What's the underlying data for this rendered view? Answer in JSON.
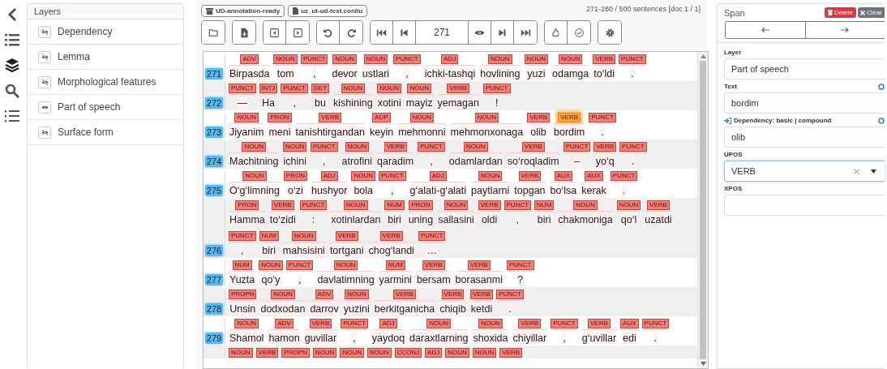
{
  "layers": {
    "title": "Layers",
    "items": [
      {
        "label": "Dependency",
        "visible": false
      },
      {
        "label": "Lemma",
        "visible": false
      },
      {
        "label": "Morphological features",
        "visible": false
      },
      {
        "label": "Part of speech",
        "visible": true
      },
      {
        "label": "Surface form",
        "visible": false
      }
    ]
  },
  "document": {
    "badges": [
      {
        "kind": "collection",
        "label": "UD-annotation-ready"
      },
      {
        "kind": "file",
        "label": "uz_ut-ud-test.conllu"
      }
    ],
    "status": "271-280 / 500 sentences [doc 1 / 1]",
    "sentence_field": "271"
  },
  "sentences": [
    {
      "number": "271",
      "tokens": [
        {
          "text": "Birpasda",
          "pos": "ADV",
          "selected": false
        },
        {
          "text": "tom",
          "pos": "NOUN",
          "selected": false
        },
        {
          "text": ",",
          "pos": "PUNCT",
          "selected": false
        },
        {
          "text": "devor",
          "pos": "NOUN",
          "selected": false
        },
        {
          "text": "ustlari",
          "pos": "NOUN",
          "selected": false
        },
        {
          "text": ",",
          "pos": "PUNCT",
          "selected": false
        },
        {
          "text": "ichki-tashqi",
          "pos": "ADJ",
          "selected": false
        },
        {
          "text": "hovlining",
          "pos": "NOUN",
          "selected": false
        },
        {
          "text": "yuzi",
          "pos": "NOUN",
          "selected": false
        },
        {
          "text": "odamga",
          "pos": "NOUN",
          "selected": false
        },
        {
          "text": "to‘ldi",
          "pos": "VERB",
          "selected": false
        },
        {
          "text": ".",
          "pos": "PUNCT",
          "selected": false
        }
      ]
    },
    {
      "number": "272",
      "tokens": [
        {
          "text": "—",
          "pos": "PUNCT",
          "selected": false
        },
        {
          "text": "Ha",
          "pos": "INTJ",
          "selected": false
        },
        {
          "text": ",",
          "pos": "PUNCT",
          "selected": false
        },
        {
          "text": "bu",
          "pos": "DET",
          "selected": false
        },
        {
          "text": "kishining",
          "pos": "NOUN",
          "selected": false
        },
        {
          "text": "xotini",
          "pos": "NOUN",
          "selected": false
        },
        {
          "text": "mayiz",
          "pos": "NOUN",
          "selected": false
        },
        {
          "text": "yemagan",
          "pos": "VERB",
          "selected": false
        },
        {
          "text": "!",
          "pos": "PUNCT",
          "selected": false
        }
      ]
    },
    {
      "number": "273",
      "tokens": [
        {
          "text": "Jiyanim",
          "pos": "NOUN",
          "selected": false
        },
        {
          "text": "meni",
          "pos": "PRON",
          "selected": false
        },
        {
          "text": "tanishtirgandan",
          "pos": "VERB",
          "selected": false
        },
        {
          "text": "keyin",
          "pos": "ADP",
          "selected": false
        },
        {
          "text": "mehmonni",
          "pos": "NOUN",
          "selected": false
        },
        {
          "text": "mehmonxonaga",
          "pos": "NOUN",
          "selected": false
        },
        {
          "text": "olib",
          "pos": "VERB",
          "selected": false
        },
        {
          "text": "bordim",
          "pos": "VERB",
          "selected": true
        },
        {
          "text": ".",
          "pos": "PUNCT",
          "selected": false
        }
      ]
    },
    {
      "number": "274",
      "tokens": [
        {
          "text": "Machitning",
          "pos": "NOUN",
          "selected": false
        },
        {
          "text": "ichini",
          "pos": "NOUN",
          "selected": false
        },
        {
          "text": ",",
          "pos": "PUNCT",
          "selected": false
        },
        {
          "text": "atrofini",
          "pos": "NOUN",
          "selected": false
        },
        {
          "text": "qaradim",
          "pos": "VERB",
          "selected": false
        },
        {
          "text": ",",
          "pos": "PUNCT",
          "selected": false
        },
        {
          "text": "odamlardan",
          "pos": "NOUN",
          "selected": false
        },
        {
          "text": "so‘roqladim",
          "pos": "VERB",
          "selected": false
        },
        {
          "text": "–",
          "pos": "PUNCT",
          "selected": false
        },
        {
          "text": "yo‘q",
          "pos": "VERB",
          "selected": false
        },
        {
          "text": ".",
          "pos": "PUNCT",
          "selected": false
        }
      ]
    },
    {
      "number": "275",
      "tokens": [
        {
          "text": "O‘g‘limning",
          "pos": "NOUN",
          "selected": false
        },
        {
          "text": "o‘zi",
          "pos": "PRON",
          "selected": false
        },
        {
          "text": "hushyor",
          "pos": "ADJ",
          "selected": false
        },
        {
          "text": "bola",
          "pos": "NOUN",
          "selected": false
        },
        {
          "text": ",",
          "pos": "PUNCT",
          "selected": false
        },
        {
          "text": "g‘alati-g‘alati",
          "pos": "ADJ",
          "selected": false
        },
        {
          "text": "paytlarni",
          "pos": "NOUN",
          "selected": false
        },
        {
          "text": "topgan",
          "pos": "VERB",
          "selected": false
        },
        {
          "text": "bo‘lsa",
          "pos": "AUX",
          "selected": false
        },
        {
          "text": "kerak",
          "pos": "AUX",
          "selected": false
        },
        {
          "text": ".",
          "pos": "PUNCT",
          "selected": false
        }
      ]
    },
    {
      "number": "276",
      "tokens": [
        {
          "text": "Hamma",
          "pos": "PRON",
          "selected": false
        },
        {
          "text": "to‘zidi",
          "pos": "VERB",
          "selected": false
        },
        {
          "text": ":",
          "pos": "PUNCT",
          "selected": false
        },
        {
          "text": "xotinlardan",
          "pos": "NOUN",
          "selected": false
        },
        {
          "text": "biri",
          "pos": "NUM",
          "selected": false
        },
        {
          "text": "uning",
          "pos": "PRON",
          "selected": false
        },
        {
          "text": "sallasini",
          "pos": "NOUN",
          "selected": false
        },
        {
          "text": "oldi",
          "pos": "VERB",
          "selected": false
        },
        {
          "text": ",",
          "pos": "PUNCT",
          "selected": false
        },
        {
          "text": "biri",
          "pos": "NUM",
          "selected": false
        },
        {
          "text": "chakmoniga",
          "pos": "NOUN",
          "selected": false
        },
        {
          "text": "qo‘l",
          "pos": "NOUN",
          "selected": false
        },
        {
          "text": "uzatdi",
          "pos": "VERB",
          "selected": false
        },
        {
          "text": ",",
          "pos": "PUNCT",
          "selected": false
        },
        {
          "text": "biri",
          "pos": "NUM",
          "selected": false
        },
        {
          "text": "mahsisini",
          "pos": "NOUN",
          "selected": false
        },
        {
          "text": "tortgani",
          "pos": "VERB",
          "selected": false
        },
        {
          "text": "chog‘landi",
          "pos": "VERB",
          "selected": false
        },
        {
          "text": "…",
          "pos": "PUNCT",
          "selected": false
        }
      ]
    },
    {
      "number": "277",
      "tokens": [
        {
          "text": "Yuzta",
          "pos": "NUM",
          "selected": false
        },
        {
          "text": "qo‘y",
          "pos": "NOUN",
          "selected": false
        },
        {
          "text": ",",
          "pos": "PUNCT",
          "selected": false
        },
        {
          "text": "davlatimning",
          "pos": "NOUN",
          "selected": false
        },
        {
          "text": "yarmini",
          "pos": "NUM",
          "selected": false
        },
        {
          "text": "bersam",
          "pos": "VERB",
          "selected": false
        },
        {
          "text": "borasanmi",
          "pos": "VERB",
          "selected": false
        },
        {
          "text": "?",
          "pos": "PUNCT",
          "selected": false
        }
      ]
    },
    {
      "number": "278",
      "tokens": [
        {
          "text": "Unsin",
          "pos": "PROPN",
          "selected": false
        },
        {
          "text": "dodxodan",
          "pos": "NOUN",
          "selected": false
        },
        {
          "text": "darrov",
          "pos": "ADV",
          "selected": false
        },
        {
          "text": "yuzini",
          "pos": "NOUN",
          "selected": false
        },
        {
          "text": "berkitganicha",
          "pos": "VERB",
          "selected": false
        },
        {
          "text": "chiqib",
          "pos": "VERB",
          "selected": false
        },
        {
          "text": "ketdi",
          "pos": "VERB",
          "selected": false
        },
        {
          "text": ".",
          "pos": "PUNCT",
          "selected": false
        }
      ]
    },
    {
      "number": "279",
      "tokens": [
        {
          "text": "Shamol",
          "pos": "NOUN",
          "selected": false
        },
        {
          "text": "hamon",
          "pos": "ADV",
          "selected": false
        },
        {
          "text": "guvillar",
          "pos": "VERB",
          "selected": false
        },
        {
          "text": ",",
          "pos": "PUNCT",
          "selected": false
        },
        {
          "text": "yaydoq",
          "pos": "ADJ",
          "selected": false
        },
        {
          "text": "daraxtlarning",
          "pos": "NOUN",
          "selected": false
        },
        {
          "text": "shoxida",
          "pos": "NOUN",
          "selected": false
        },
        {
          "text": "chiyillar",
          "pos": "VERB",
          "selected": false
        },
        {
          "text": ",",
          "pos": "PUNCT",
          "selected": false
        },
        {
          "text": "g‘uvillar",
          "pos": "VERB",
          "selected": false
        },
        {
          "text": "edi",
          "pos": "AUX",
          "selected": false
        },
        {
          "text": ".",
          "pos": "PUNCT",
          "selected": false
        }
      ]
    },
    {
      "tokens": [
        {
          "pos": "NOUN",
          "selected": false
        },
        {
          "pos": "VERB",
          "selected": false
        },
        {
          "pos": "PROPN",
          "selected": false
        },
        {
          "pos": "NOUN",
          "selected": false
        },
        {
          "pos": "NOUN",
          "selected": false
        },
        {
          "pos": "NOUN",
          "selected": false
        },
        {
          "pos": "CCONJ",
          "selected": false
        },
        {
          "pos": "ADJ",
          "selected": false
        },
        {
          "pos": "NOUN",
          "selected": false
        },
        {
          "pos": "NOUN",
          "selected": false
        },
        {
          "pos": "VERB",
          "selected": false
        }
      ]
    }
  ],
  "span": {
    "title": "Span",
    "delete": "Delete",
    "clear": "Clear",
    "fields": [
      {
        "kind": "plain",
        "label": "Layer",
        "value": "Part of speech",
        "focused": false
      },
      {
        "kind": "feature",
        "label": "Text",
        "value": "bordim",
        "focused": false
      },
      {
        "kind": "relation",
        "label": "Dependency: basic | compound",
        "value": "olib",
        "focused": false
      },
      {
        "kind": "combo",
        "label": "UPOS",
        "value": "VERB",
        "focused": true
      },
      {
        "kind": "plain",
        "label": "XPOS",
        "focused": false
      }
    ]
  }
}
